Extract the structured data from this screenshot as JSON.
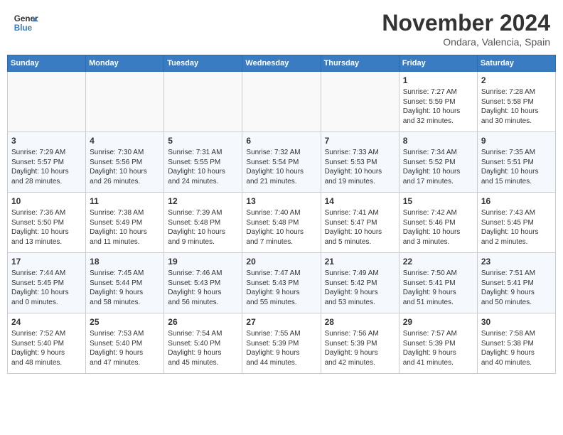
{
  "header": {
    "logo_line1": "General",
    "logo_line2": "Blue",
    "month": "November 2024",
    "location": "Ondara, Valencia, Spain"
  },
  "days_of_week": [
    "Sunday",
    "Monday",
    "Tuesday",
    "Wednesday",
    "Thursday",
    "Friday",
    "Saturday"
  ],
  "weeks": [
    [
      {
        "day": "",
        "info": ""
      },
      {
        "day": "",
        "info": ""
      },
      {
        "day": "",
        "info": ""
      },
      {
        "day": "",
        "info": ""
      },
      {
        "day": "",
        "info": ""
      },
      {
        "day": "1",
        "info": "Sunrise: 7:27 AM\nSunset: 5:59 PM\nDaylight: 10 hours\nand 32 minutes."
      },
      {
        "day": "2",
        "info": "Sunrise: 7:28 AM\nSunset: 5:58 PM\nDaylight: 10 hours\nand 30 minutes."
      }
    ],
    [
      {
        "day": "3",
        "info": "Sunrise: 7:29 AM\nSunset: 5:57 PM\nDaylight: 10 hours\nand 28 minutes."
      },
      {
        "day": "4",
        "info": "Sunrise: 7:30 AM\nSunset: 5:56 PM\nDaylight: 10 hours\nand 26 minutes."
      },
      {
        "day": "5",
        "info": "Sunrise: 7:31 AM\nSunset: 5:55 PM\nDaylight: 10 hours\nand 24 minutes."
      },
      {
        "day": "6",
        "info": "Sunrise: 7:32 AM\nSunset: 5:54 PM\nDaylight: 10 hours\nand 21 minutes."
      },
      {
        "day": "7",
        "info": "Sunrise: 7:33 AM\nSunset: 5:53 PM\nDaylight: 10 hours\nand 19 minutes."
      },
      {
        "day": "8",
        "info": "Sunrise: 7:34 AM\nSunset: 5:52 PM\nDaylight: 10 hours\nand 17 minutes."
      },
      {
        "day": "9",
        "info": "Sunrise: 7:35 AM\nSunset: 5:51 PM\nDaylight: 10 hours\nand 15 minutes."
      }
    ],
    [
      {
        "day": "10",
        "info": "Sunrise: 7:36 AM\nSunset: 5:50 PM\nDaylight: 10 hours\nand 13 minutes."
      },
      {
        "day": "11",
        "info": "Sunrise: 7:38 AM\nSunset: 5:49 PM\nDaylight: 10 hours\nand 11 minutes."
      },
      {
        "day": "12",
        "info": "Sunrise: 7:39 AM\nSunset: 5:48 PM\nDaylight: 10 hours\nand 9 minutes."
      },
      {
        "day": "13",
        "info": "Sunrise: 7:40 AM\nSunset: 5:48 PM\nDaylight: 10 hours\nand 7 minutes."
      },
      {
        "day": "14",
        "info": "Sunrise: 7:41 AM\nSunset: 5:47 PM\nDaylight: 10 hours\nand 5 minutes."
      },
      {
        "day": "15",
        "info": "Sunrise: 7:42 AM\nSunset: 5:46 PM\nDaylight: 10 hours\nand 3 minutes."
      },
      {
        "day": "16",
        "info": "Sunrise: 7:43 AM\nSunset: 5:45 PM\nDaylight: 10 hours\nand 2 minutes."
      }
    ],
    [
      {
        "day": "17",
        "info": "Sunrise: 7:44 AM\nSunset: 5:45 PM\nDaylight: 10 hours\nand 0 minutes."
      },
      {
        "day": "18",
        "info": "Sunrise: 7:45 AM\nSunset: 5:44 PM\nDaylight: 9 hours\nand 58 minutes."
      },
      {
        "day": "19",
        "info": "Sunrise: 7:46 AM\nSunset: 5:43 PM\nDaylight: 9 hours\nand 56 minutes."
      },
      {
        "day": "20",
        "info": "Sunrise: 7:47 AM\nSunset: 5:43 PM\nDaylight: 9 hours\nand 55 minutes."
      },
      {
        "day": "21",
        "info": "Sunrise: 7:49 AM\nSunset: 5:42 PM\nDaylight: 9 hours\nand 53 minutes."
      },
      {
        "day": "22",
        "info": "Sunrise: 7:50 AM\nSunset: 5:41 PM\nDaylight: 9 hours\nand 51 minutes."
      },
      {
        "day": "23",
        "info": "Sunrise: 7:51 AM\nSunset: 5:41 PM\nDaylight: 9 hours\nand 50 minutes."
      }
    ],
    [
      {
        "day": "24",
        "info": "Sunrise: 7:52 AM\nSunset: 5:40 PM\nDaylight: 9 hours\nand 48 minutes."
      },
      {
        "day": "25",
        "info": "Sunrise: 7:53 AM\nSunset: 5:40 PM\nDaylight: 9 hours\nand 47 minutes."
      },
      {
        "day": "26",
        "info": "Sunrise: 7:54 AM\nSunset: 5:40 PM\nDaylight: 9 hours\nand 45 minutes."
      },
      {
        "day": "27",
        "info": "Sunrise: 7:55 AM\nSunset: 5:39 PM\nDaylight: 9 hours\nand 44 minutes."
      },
      {
        "day": "28",
        "info": "Sunrise: 7:56 AM\nSunset: 5:39 PM\nDaylight: 9 hours\nand 42 minutes."
      },
      {
        "day": "29",
        "info": "Sunrise: 7:57 AM\nSunset: 5:39 PM\nDaylight: 9 hours\nand 41 minutes."
      },
      {
        "day": "30",
        "info": "Sunrise: 7:58 AM\nSunset: 5:38 PM\nDaylight: 9 hours\nand 40 minutes."
      }
    ]
  ]
}
